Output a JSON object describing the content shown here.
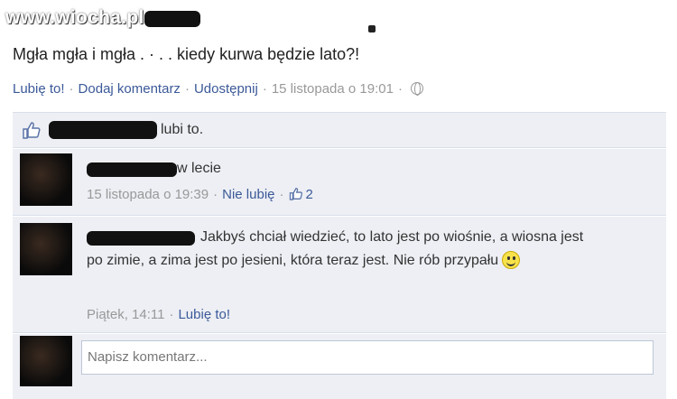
{
  "watermark": "www.wiocha.pl",
  "post": {
    "text": "Mgła mgła i mgła . · . . kiedy kurwa będzie lato?!",
    "actions": {
      "like": "Lubię to!",
      "comment": "Dodaj komentarz",
      "share": "Udostępnij",
      "time": "15 listopada o 19:01",
      "separator": "·"
    }
  },
  "likes": {
    "suffix": "lubi to."
  },
  "comments": [
    {
      "text": "w lecie",
      "time": "15 listopada o 19:39",
      "unlike": "Nie lubię",
      "like_count": "2"
    },
    {
      "text": "Jakbyś chciał wiedzieć, to lato jest po wiośnie, a wiosna jest po zimie, a zima jest po jesieni, która teraz jest. Nie rób przypału",
      "time": "Piątek, 14:11",
      "like": "Lubię to!"
    }
  ],
  "composer": {
    "placeholder": "Napisz komentarz..."
  },
  "icons": [
    "thumbs-up-icon",
    "globe-icon",
    "smiley-icon"
  ],
  "colors": {
    "link": "#3b5998",
    "panel": "#edeff4",
    "muted": "#999999"
  }
}
